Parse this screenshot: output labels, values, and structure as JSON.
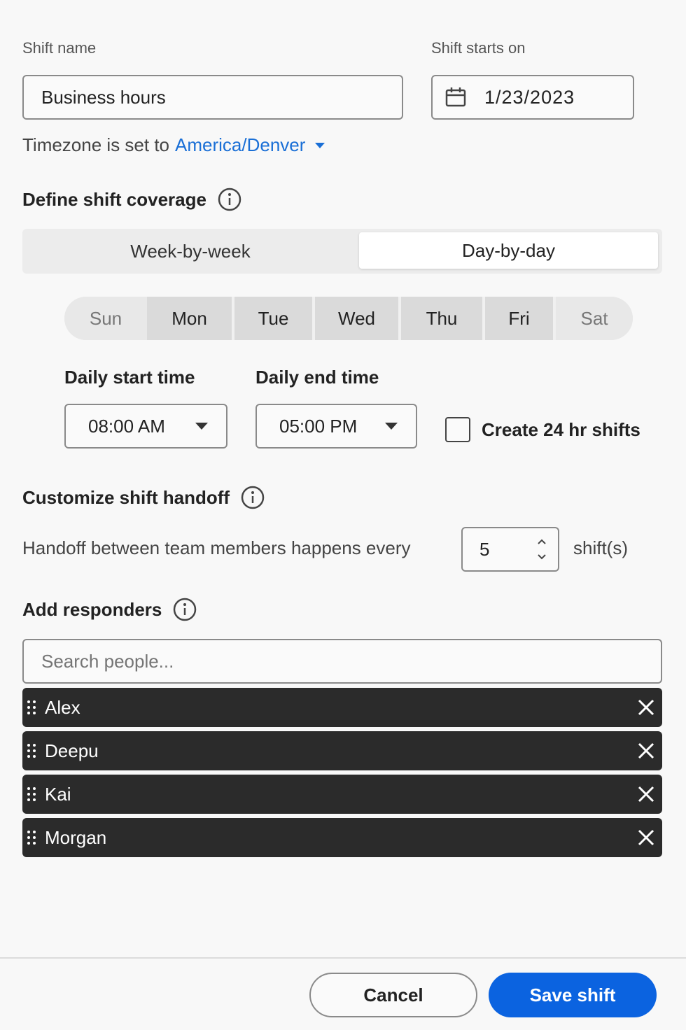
{
  "shift": {
    "name_label": "Shift name",
    "name_value": "Business hours",
    "start_label": "Shift starts on",
    "start_value": "1/23/2023",
    "timezone_prefix": "Timezone is set to",
    "timezone_value": "America/Denver"
  },
  "coverage": {
    "title": "Define shift coverage",
    "tabs": [
      {
        "label": "Week-by-week",
        "active": false
      },
      {
        "label": "Day-by-day",
        "active": true
      }
    ],
    "days": [
      {
        "label": "Sun",
        "selected": false
      },
      {
        "label": "Mon",
        "selected": true
      },
      {
        "label": "Tue",
        "selected": true
      },
      {
        "label": "Wed",
        "selected": true
      },
      {
        "label": "Thu",
        "selected": true
      },
      {
        "label": "Fri",
        "selected": true
      },
      {
        "label": "Sat",
        "selected": false
      }
    ],
    "start_time_label": "Daily start time",
    "start_time_value": "08:00 AM",
    "end_time_label": "Daily end time",
    "end_time_value": "05:00 PM",
    "create_24hr_label": "Create 24 hr shifts",
    "create_24hr_checked": false
  },
  "handoff": {
    "title": "Customize shift handoff",
    "text": "Handoff between team members happens every",
    "value": "5",
    "unit": "shift(s)"
  },
  "responders": {
    "title": "Add responders",
    "search_placeholder": "Search people...",
    "people": [
      "Alex",
      "Deepu",
      "Kai",
      "Morgan"
    ]
  },
  "footer": {
    "cancel_label": "Cancel",
    "save_label": "Save shift"
  },
  "colors": {
    "accent": "#0b63e0",
    "link": "#1a6fd6",
    "chip_bg": "#2b2b2b"
  },
  "icons": {
    "calendar": "calendar-icon",
    "info": "info-icon",
    "drag": "drag-handle-icon",
    "remove": "close-icon"
  }
}
